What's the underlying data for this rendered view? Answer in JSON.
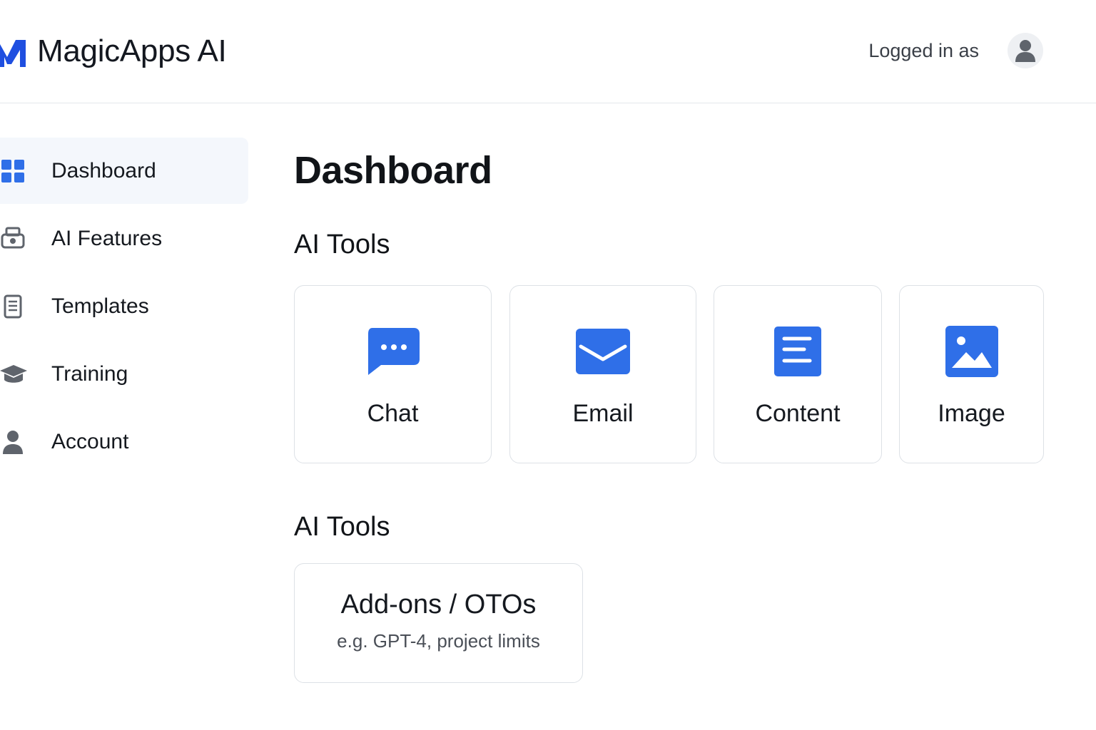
{
  "header": {
    "brand_name": "MagicApps AI",
    "logged_in_text": "Logged in as"
  },
  "colors": {
    "accent": "#2f6fe8",
    "icon_gray": "#5f646c",
    "active_bg": "#f4f7fc"
  },
  "sidebar": {
    "items": [
      {
        "label": "Dashboard",
        "icon": "grid-icon",
        "active": true
      },
      {
        "label": "AI Features",
        "icon": "printer-icon",
        "active": false
      },
      {
        "label": "Templates",
        "icon": "document-icon",
        "active": false
      },
      {
        "label": "Training",
        "icon": "graduation-cap-icon",
        "active": false
      },
      {
        "label": "Account",
        "icon": "user-icon",
        "active": false
      }
    ]
  },
  "main": {
    "title": "Dashboard",
    "sections": [
      {
        "title": "AI Tools",
        "tools": [
          {
            "label": "Chat",
            "icon": "chat-bubble-icon"
          },
          {
            "label": "Email",
            "icon": "envelope-icon"
          },
          {
            "label": "Content",
            "icon": "content-doc-icon"
          },
          {
            "label": "Image",
            "icon": "image-icon"
          }
        ]
      },
      {
        "title": "AI Tools",
        "addon": {
          "title": "Add-ons / OTOs",
          "subtitle": "e.g. GPT-4, project limits"
        }
      }
    ]
  }
}
